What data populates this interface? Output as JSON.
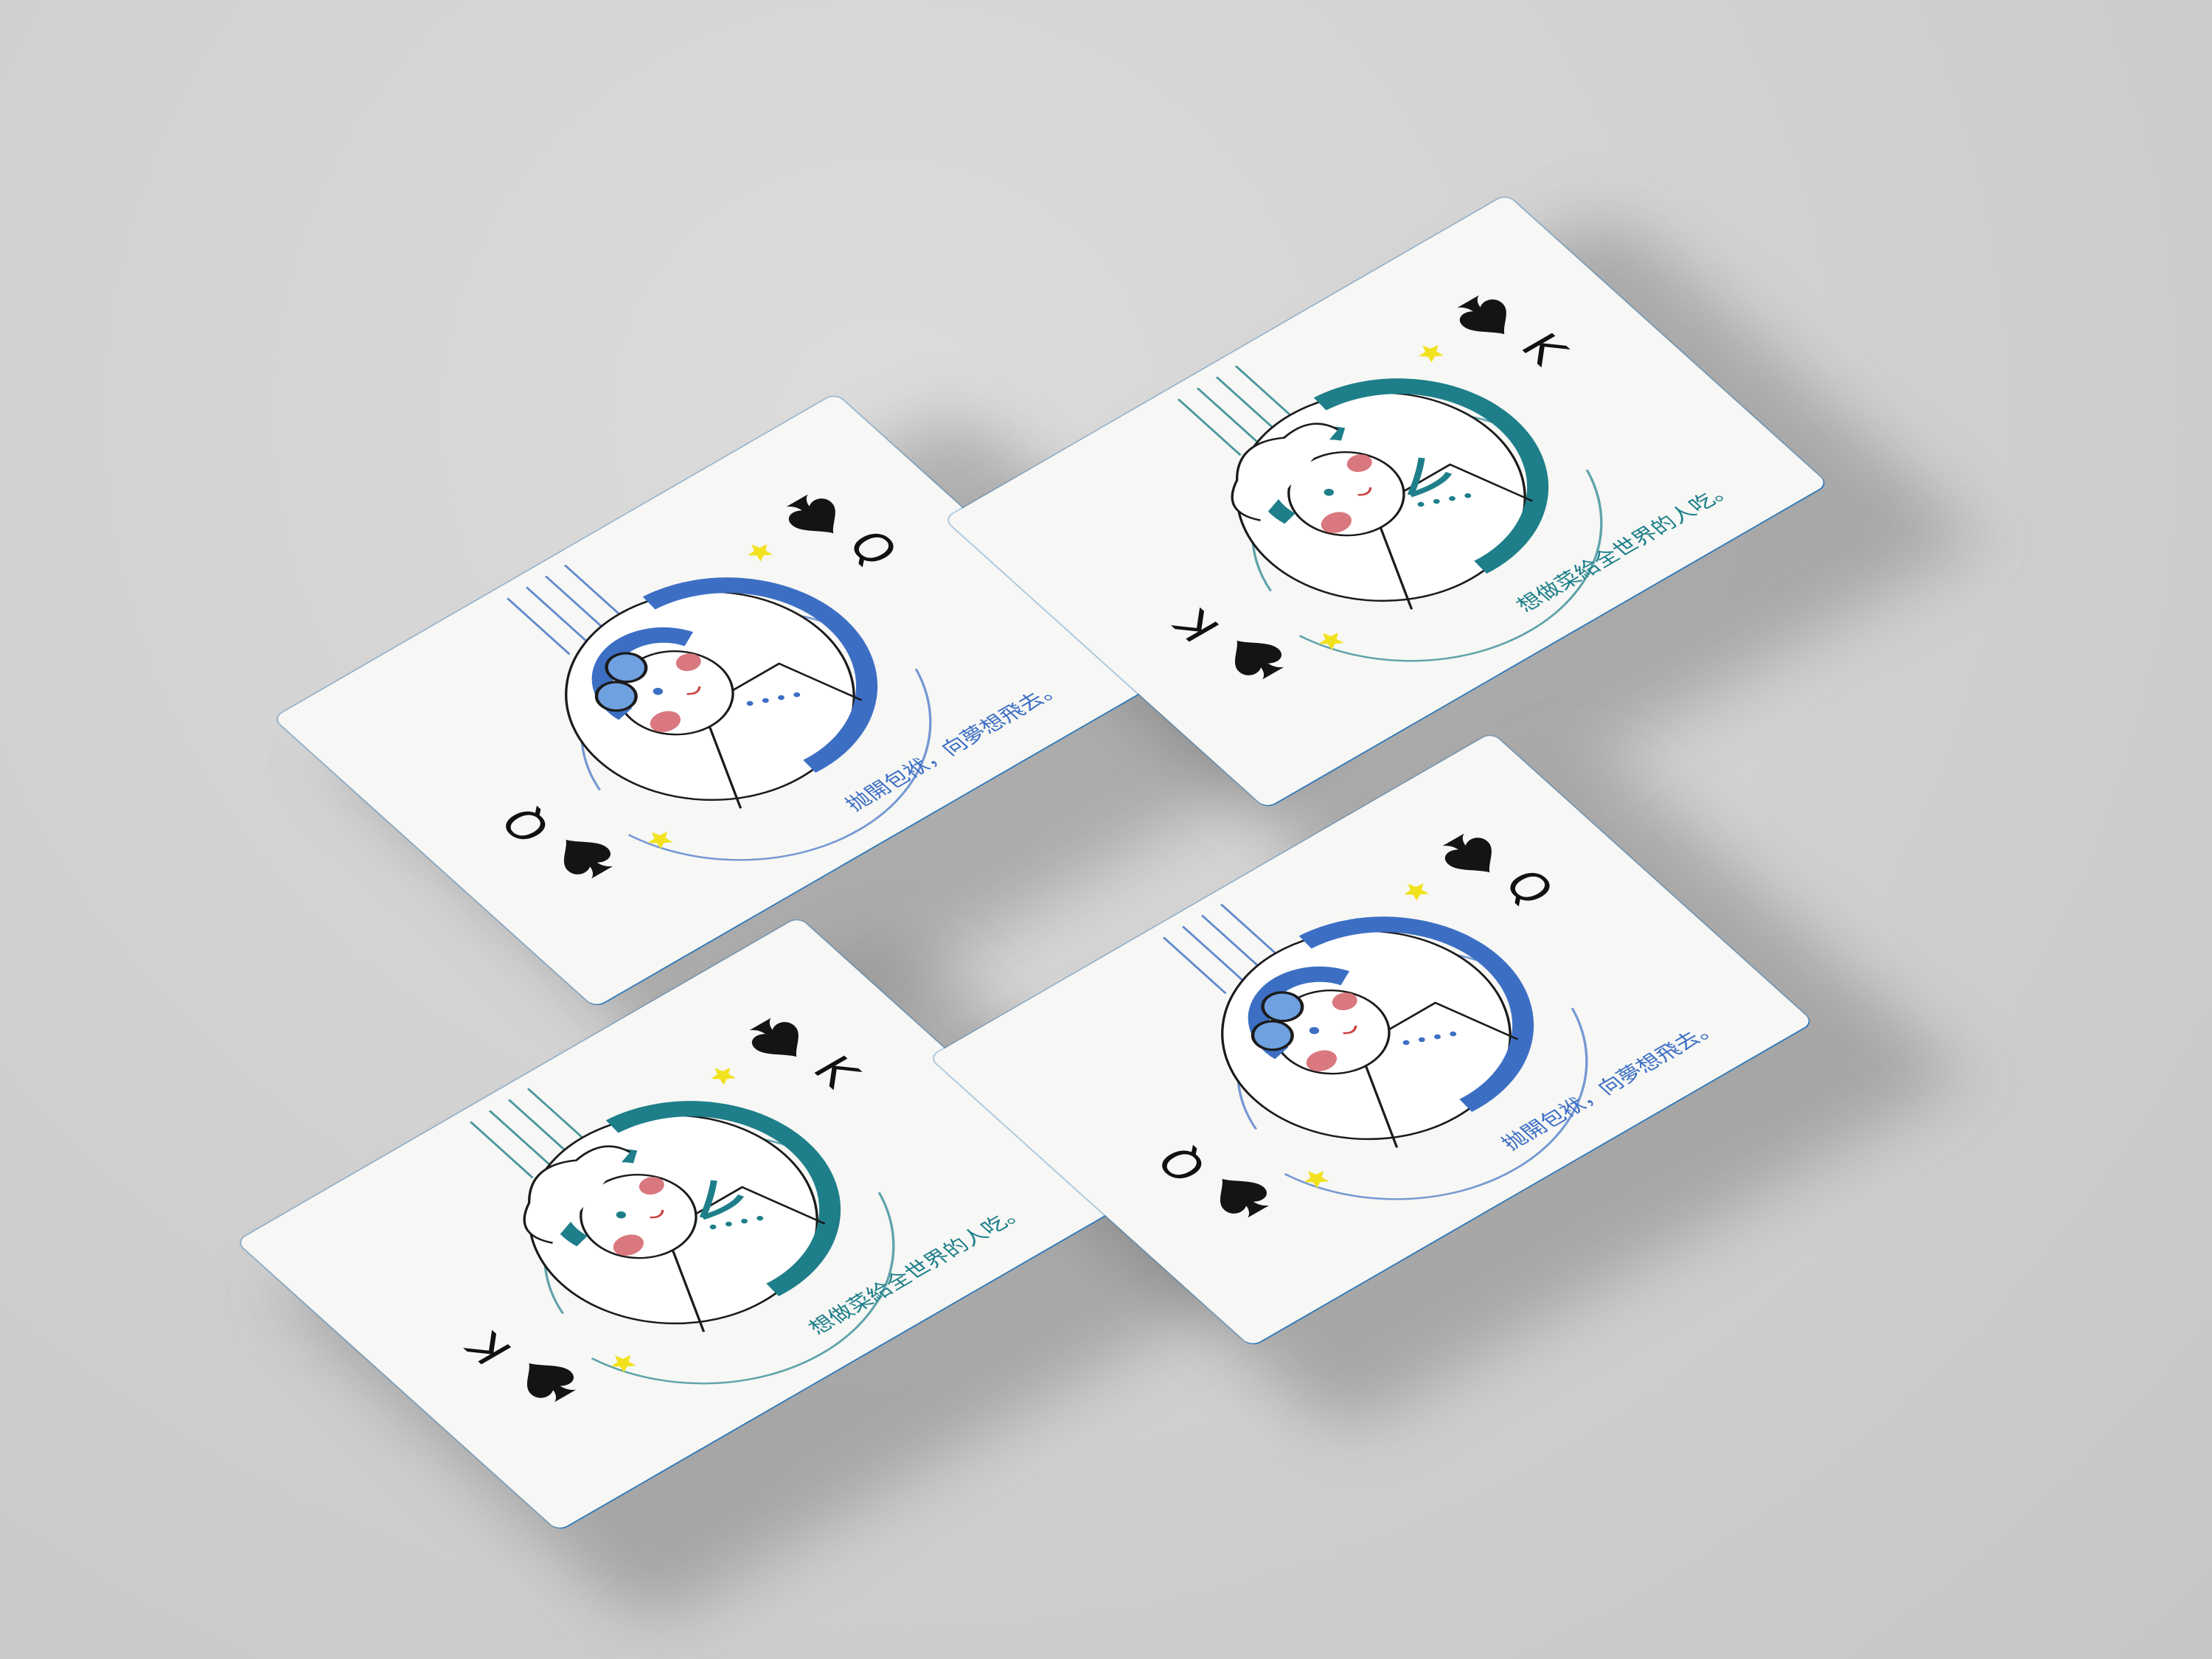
{
  "background_color": "#d4d4d4",
  "cards": [
    {
      "rank": "Q",
      "suit": "spade",
      "slogan": "抛開包袱，向夢想飛去。",
      "accent": "#3c6fc4",
      "character": "aviator-with-goggles"
    },
    {
      "rank": "K",
      "suit": "spade",
      "slogan": "想做菜給全世界的人吃。",
      "accent": "#1e7f8a",
      "character": "chef-with-hat"
    },
    {
      "rank": "K",
      "suit": "spade",
      "slogan": "想做菜給全世界的人吃。",
      "accent": "#1e7f8a",
      "character": "chef-with-hat"
    },
    {
      "rank": "Q",
      "suit": "spade",
      "slogan": "抛開包袱，向夢想飛去。",
      "accent": "#3c6fc4",
      "character": "aviator-with-goggles"
    }
  ],
  "colors": {
    "star": "#f2e21d",
    "cheek": "#d9787e",
    "outline": "#1b1b1b",
    "skin": "#ffffff"
  }
}
